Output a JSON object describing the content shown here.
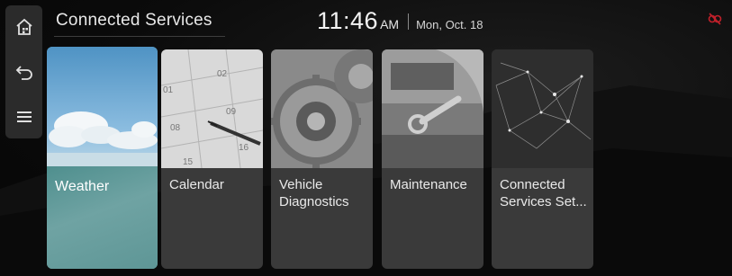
{
  "header": {
    "title": "Connected Services",
    "time": "11:46",
    "ampm": "AM",
    "date": "Mon, Oct. 18"
  },
  "rail": {
    "items": [
      {
        "icon": "home-icon"
      },
      {
        "icon": "back-icon"
      },
      {
        "icon": "menu-icon"
      }
    ]
  },
  "status": {
    "icon": "connection-off-icon",
    "color": "#c0202a"
  },
  "cards": [
    {
      "id": "weather",
      "label": "Weather",
      "selected": true
    },
    {
      "id": "calendar",
      "label": "Calendar"
    },
    {
      "id": "vehicle-diagnostics",
      "label": "Vehicle\nDiagnostics"
    },
    {
      "id": "maintenance",
      "label": "Maintenance"
    },
    {
      "id": "connected-services-settings",
      "label": "Connected\nServices Set..."
    }
  ],
  "calendar_numbers": [
    "02",
    "09",
    "08",
    "16",
    "15",
    "01"
  ],
  "colors": {
    "background": "#0b0b0b",
    "rail": "#2b2b2b",
    "card": "#3a3a3a",
    "weather_card": "#6b9b9c",
    "status_red": "#c0202a"
  }
}
